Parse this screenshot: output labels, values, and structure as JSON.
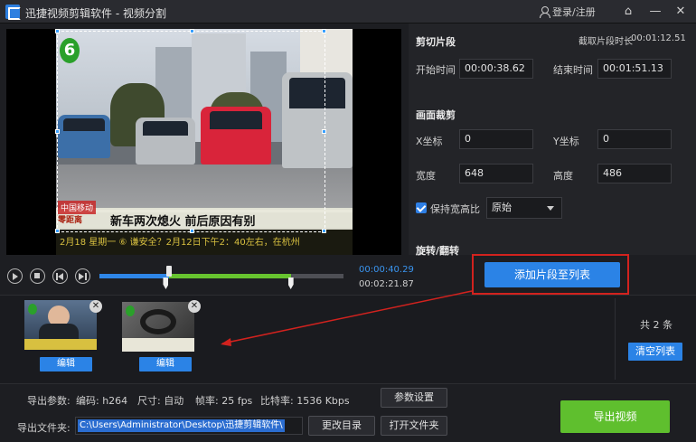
{
  "window": {
    "title": "迅捷视频剪辑软件 - 视频分割",
    "login_label": "登录/注册"
  },
  "video": {
    "channel_logo": "6",
    "news_tag": "中国移动",
    "news_tag2": "零距离",
    "ticker_headline": "新车两次熄火 前后原因有别",
    "scroll_text": "2月18 星期一 ⑥ 谦安全？2月12日下午2：40左右，在杭州"
  },
  "panel": {
    "cut_section_title": "剪切片段",
    "clip_duration_label": "截取片段时长",
    "clip_duration_value": "00:01:12.51",
    "start_time_label": "开始时间",
    "start_time_value": "00:00:38.62",
    "end_time_label": "结束时间",
    "end_time_value": "00:01:51.13",
    "crop_section_title": "画面裁剪",
    "x_label": "X坐标",
    "x_value": "0",
    "y_label": "Y坐标",
    "y_value": "0",
    "width_label": "宽度",
    "width_value": "648",
    "height_label": "高度",
    "height_value": "486",
    "keep_ratio_label": "保持宽高比",
    "ratio_value": "原始",
    "rotate_section_title": "旋转/翻转"
  },
  "playback": {
    "current_time": "00:00:40.29",
    "total_time": "00:02:21.87",
    "playhead_fraction": 0.284,
    "clip_start_fraction": 0.272,
    "clip_end_fraction": 0.784,
    "add_button": "添加片段至列表"
  },
  "clips": {
    "items": [
      {
        "edit_label": "编辑"
      },
      {
        "edit_label": "编辑"
      }
    ],
    "count_label": "共 2 条",
    "clear_button": "清空列表"
  },
  "export": {
    "params_label": "导出参数:",
    "codec": "编码: h264",
    "size": "尺寸: 自动",
    "fps": "帧率: 25 fps",
    "bitrate": "比特率: 1536 Kbps",
    "params_button": "参数设置",
    "folder_label": "导出文件夹:",
    "folder_value": "C:\\Users\\Administrator\\Desktop\\迅捷剪辑软件\\",
    "change_dir_button": "更改目录",
    "open_folder_button": "打开文件夹",
    "export_button": "导出视频"
  },
  "colors": {
    "accent_blue": "#2b83e6",
    "export_green": "#5fbf2e",
    "highlight_red": "#d2221e"
  }
}
